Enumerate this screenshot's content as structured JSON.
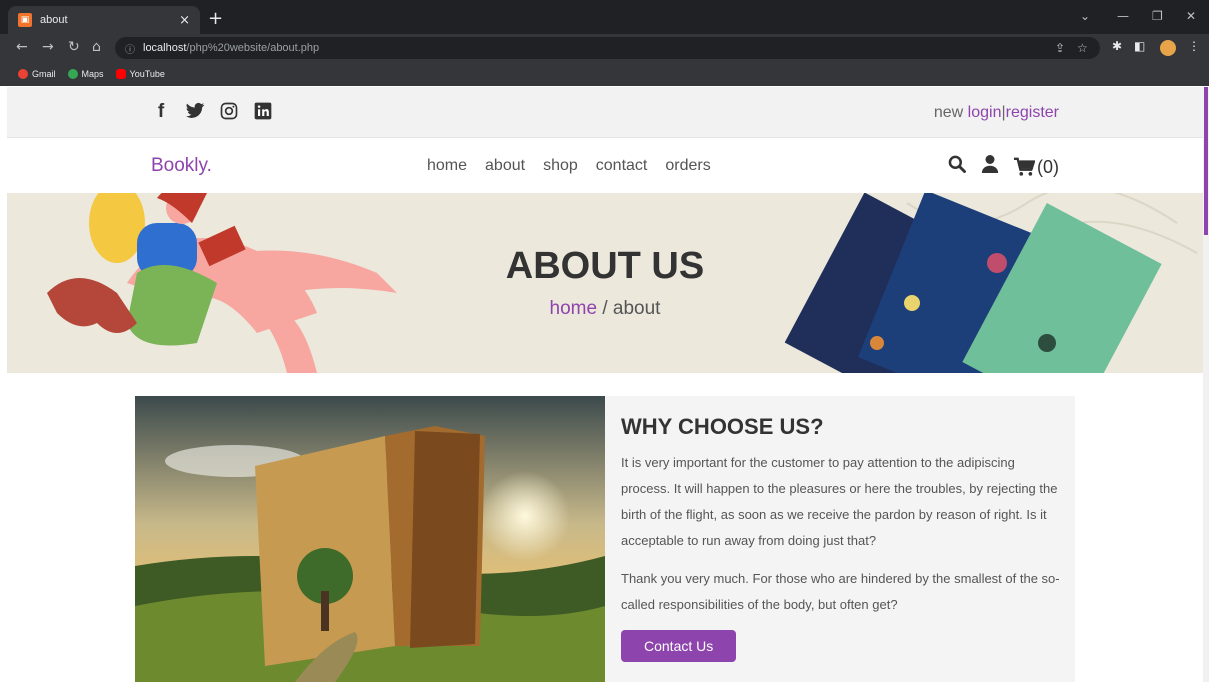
{
  "browser": {
    "tab_title": "about",
    "tab_close": "×",
    "new_tab": "+",
    "url_host": "localhost",
    "url_path": "/php%20website/about.php",
    "bookmarks": [
      {
        "label": "Gmail",
        "icon": "maps-pin-icon",
        "color": "#ea4335"
      },
      {
        "label": "Maps",
        "icon": "maps-pin-icon",
        "color": "#34a853"
      },
      {
        "label": "YouTube",
        "icon": "youtube-icon",
        "color": "#ff0000"
      }
    ]
  },
  "topbar": {
    "auth_prefix": "new",
    "login": "login",
    "separator": "|",
    "register": "register"
  },
  "header": {
    "logo": "Bookly.",
    "nav": [
      "home",
      "about",
      "shop",
      "contact",
      "orders"
    ],
    "cart_count": "(0)"
  },
  "hero": {
    "title": "ABOUT US",
    "crumb_home": "home",
    "crumb_current": "/ about"
  },
  "about": {
    "title": "WHY CHOOSE US?",
    "paragraph1": "It is very important for the customer to pay attention to the adipiscing process. It will happen to the pleasures or here the troubles, by rejecting the birth of the flight, as soon as we receive the pardon by reason of right. Is it acceptable to run away from doing just that?",
    "paragraph2": "Thank you very much. For those who are hindered by the smallest of the so-called responsibilities of the body, but often get?",
    "button": "Contact Us"
  },
  "colors": {
    "accent": "#8e44ad",
    "chrome_dark": "#202124"
  }
}
